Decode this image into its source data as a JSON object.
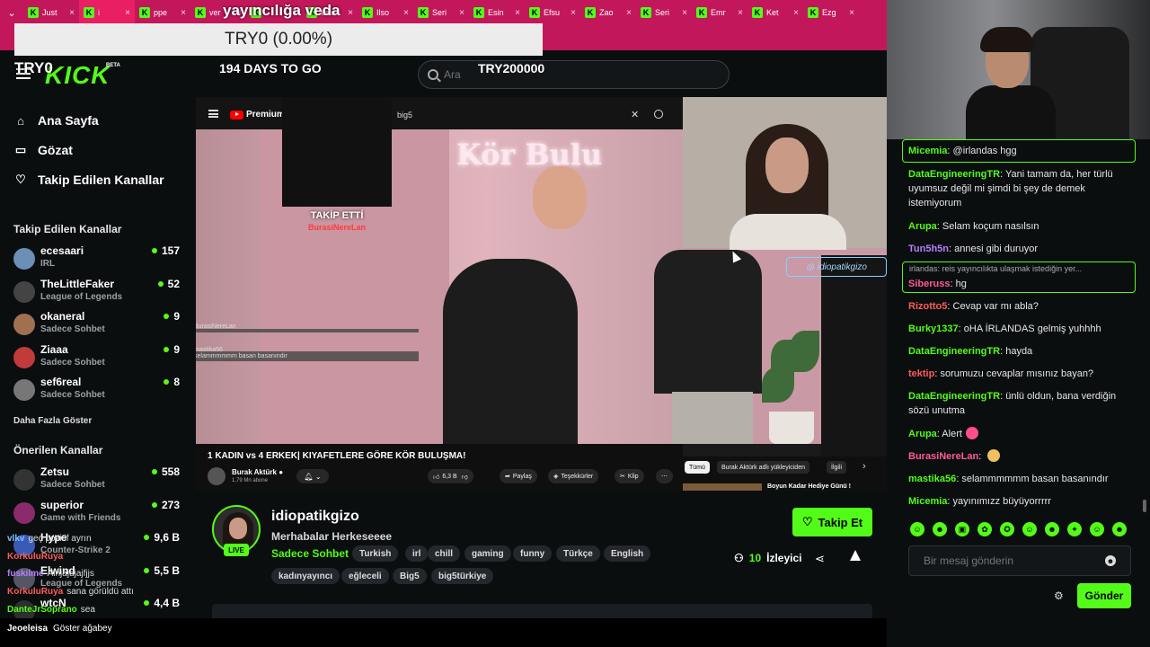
{
  "browser": {
    "tabs": [
      {
        "label": "Just",
        "active": false
      },
      {
        "label": "i",
        "active": true
      },
      {
        "label": "ppe",
        "active": false
      },
      {
        "label": "ver",
        "active": false
      },
      {
        "label": "",
        "active": false
      },
      {
        "label": "esin",
        "active": false
      },
      {
        "label": "Ilso",
        "active": false
      },
      {
        "label": "Seri",
        "active": false
      },
      {
        "label": "Esin",
        "active": false
      },
      {
        "label": "Efsu",
        "active": false
      },
      {
        "label": "Zao",
        "active": false
      },
      {
        "label": "Seri",
        "active": false
      },
      {
        "label": "Emr",
        "active": false
      },
      {
        "label": "Ket",
        "active": false
      },
      {
        "label": "Ezg",
        "active": false
      }
    ],
    "tab_icon_letter": "K",
    "tab_close": "×"
  },
  "overlay": {
    "banner": "yayıncılığa veda",
    "ticker": "TRY0 (0.00%)",
    "try0": "TRY0",
    "days": "194 DAYS TO GO",
    "try2": "TRY200000"
  },
  "header": {
    "logo": "KICK",
    "beta": "BETA",
    "search_placeholder": "Ara"
  },
  "sidebar": {
    "nav": [
      {
        "label": "Ana Sayfa",
        "icon": "home-icon",
        "glyph": "⌂"
      },
      {
        "label": "Gözat",
        "icon": "browse-icon",
        "glyph": "▭"
      },
      {
        "label": "Takip Edilen Kanallar",
        "icon": "heart-icon",
        "glyph": "♡"
      }
    ],
    "followed_heading": "Takip Edilen Kanallar",
    "followed": [
      {
        "name": "ecesaari",
        "category": "IRL",
        "viewers": "157",
        "color": "#6b8fb5"
      },
      {
        "name": "TheLittleFaker",
        "category": "League of Legends",
        "viewers": "52",
        "color": "#444"
      },
      {
        "name": "okaneral",
        "category": "Sadece Sohbet",
        "viewers": "9",
        "color": "#a07050"
      },
      {
        "name": "Ziaaa",
        "category": "Sadece Sohbet",
        "viewers": "9",
        "color": "#c23a3a"
      },
      {
        "name": "sef6real",
        "category": "Sadece Sohbet",
        "viewers": "8",
        "color": "#777"
      }
    ],
    "show_more": "Daha Fazla Göster",
    "recommended_heading": "Önerilen Kanallar",
    "recommended": [
      {
        "name": "Zetsu",
        "category": "Sadece Sohbet",
        "viewers": "558",
        "color": "#333"
      },
      {
        "name": "superior",
        "category": "Game with Friends",
        "viewers": "273",
        "color": "#8a2b6b"
      },
      {
        "name": "Hype",
        "category": "Counter-Strike 2",
        "viewers": "9,6 B",
        "color": "#3a5bb5"
      },
      {
        "name": "Elwind",
        "category": "League of Legends",
        "viewers": "5,5 B",
        "color": "#556"
      },
      {
        "name": "wtcN",
        "category": "",
        "viewers": "4,4 B",
        "color": "#2e2e2e"
      }
    ]
  },
  "stream_overlay_chat": [
    {
      "user": "vlkv",
      "text": "geç pozitif ayrın",
      "color": "#7fc3ff"
    },
    {
      "user": "KorkuluRuya",
      "text": "",
      "color": "#ff5a5a"
    },
    {
      "user": "fuskilme",
      "text": "Alnjajdjajfjjs",
      "color": "#b57fff"
    },
    {
      "user": "KorkuluRuya",
      "text": "sana görüldü attı",
      "color": "#ff5a5a"
    },
    {
      "user": "DanteJrSoprano",
      "text": "sea",
      "color": "#53fc18"
    }
  ],
  "bottom_bar": {
    "user": "Jeoeleisa",
    "message": "Göster ağabey"
  },
  "video": {
    "yt_brand": "Premium",
    "yt_query": "big5",
    "neon_sign": "Kör Bulu",
    "follow_alert_title": "TAKİP ETTİ",
    "follow_alert_user": "BurasiNereLan",
    "mini_chat": [
      {
        "text": "BurasiNereLan",
        "bg": false
      },
      {
        "text": "",
        "bg": true
      },
      {
        "text": "mastika56",
        "bg": false
      },
      {
        "text": "selammmmmm basan basanındır",
        "bg": true
      }
    ],
    "ig_handle": "idiopatikgizo",
    "video_title": "1 KADIN vs 4 ERKEK| KIYAFETLERE GÖRE KÖR BULUŞMA!",
    "yt_channel": "Burak Aktürk",
    "yt_subs": "1,79 Mn abone",
    "likes": "6,3 B",
    "share": "Paylaş",
    "thanks": "Teşekkürler",
    "clip": "Klip",
    "chips": [
      "Tümü",
      "Burak Aktürk adlı yükleyiciden",
      "İlgili"
    ],
    "rec_title": "Boyun Kadar Hediye Günü !"
  },
  "channel": {
    "name": "idiopatikgizo",
    "title": "Merhabalar Herkeseeee",
    "category": "Sadece Sohbet",
    "tags_row1": [
      "Turkish",
      "irl",
      "chill",
      "gaming",
      "funny",
      "Türkçe",
      "English"
    ],
    "tags_row2": [
      "kadınyayıncı",
      "eğleceli",
      "Big5",
      "big5türkiye"
    ],
    "live": "LIVE",
    "follow_label": "Takip Et",
    "viewers_num": "10",
    "viewers_label": "İzleyici"
  },
  "chat": {
    "messages": [
      {
        "user": "Micemia",
        "text": "@irlandas hgg",
        "color": "#53fc18",
        "pinned": true
      },
      {
        "user": "DataEngineeringTR",
        "text": "Yani tamam da, her türlü uyumsuz değil mi şimdi bi şey de demek istemiyorum",
        "color": "#53fc18"
      },
      {
        "user": "Arupa",
        "text": "Selam koçum nasılsın",
        "color": "#53fc18"
      },
      {
        "user": "Tun5h5n",
        "text": "annesi gibi duruyor",
        "color": "#b57fff"
      },
      {
        "user": "Siberuss",
        "text": "hg",
        "color": "#ff5a9a",
        "reply": "irlandas: reis yayıncılıkta ulaşmak istediğin yer..."
      },
      {
        "user": "Rizotto5",
        "text": "Cevap var mı abla?",
        "color": "#ff5a5a"
      },
      {
        "user": "Burky1337",
        "text": "oHA İRLANDAS gelmiş yuhhhh",
        "color": "#53fc18"
      },
      {
        "user": "DataEngineeringTR",
        "text": "hayda",
        "color": "#53fc18"
      },
      {
        "user": "tektip",
        "text": "sorumuzu cevaplar mısınız bayan?",
        "color": "#ff5a5a"
      },
      {
        "user": "DataEngineeringTR",
        "text": "ünlü oldun, bana verdiğin sözü unutma",
        "color": "#53fc18"
      },
      {
        "user": "Arupa",
        "text": "Alert",
        "color": "#53fc18",
        "emote": "#ff4d8f"
      },
      {
        "user": "BurasiNereLan",
        "text": "",
        "color": "#ff5a9a",
        "emote": "#f0c060"
      },
      {
        "user": "mastika56",
        "text": "selammmmmm basan basanındır",
        "color": "#53fc18"
      },
      {
        "user": "Micemia",
        "text": "yayınımızz büyüyorrrrr",
        "color": "#53fc18"
      }
    ],
    "emotes": [
      "☺",
      "☻",
      "▣",
      "✿",
      "✪",
      "☺",
      "☻",
      "✦",
      "☺",
      "☻"
    ],
    "input_placeholder": "Bir mesaj gönderin",
    "send_label": "Gönder"
  }
}
